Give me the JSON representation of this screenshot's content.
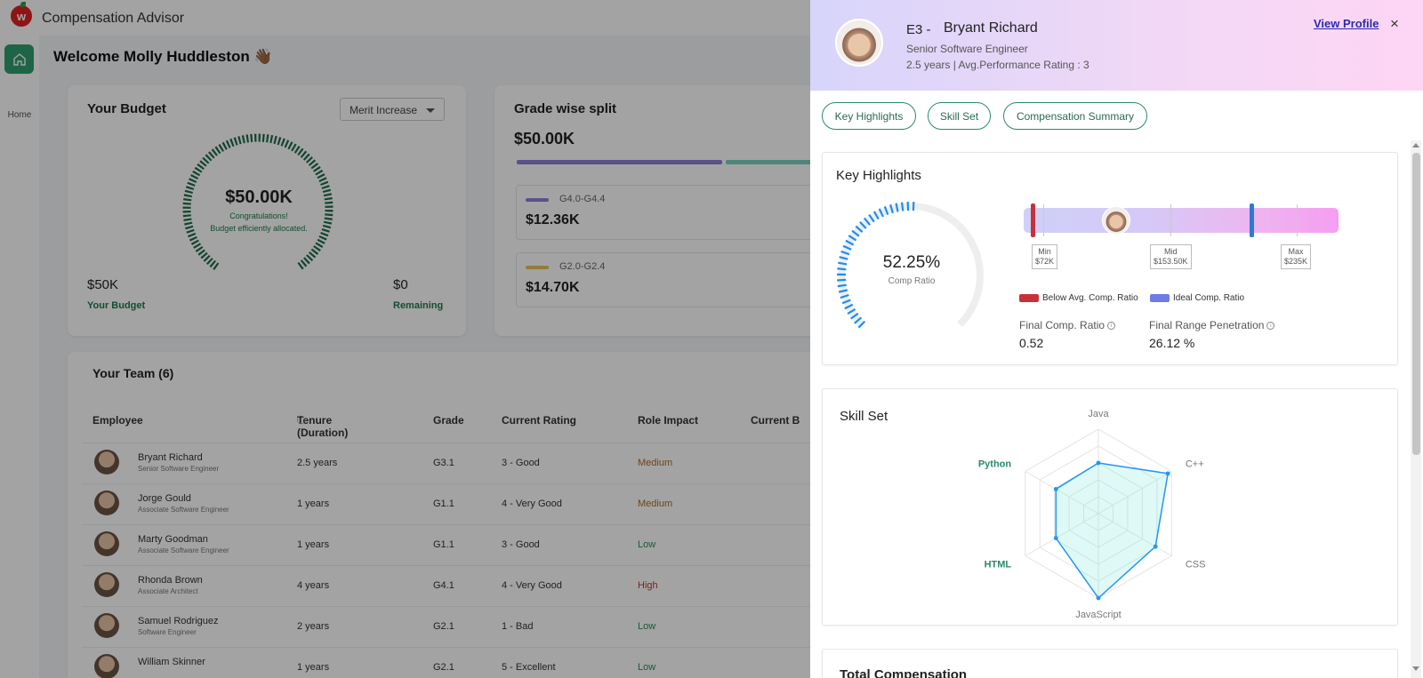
{
  "app": {
    "title": "Compensation Advisor",
    "logo": "w"
  },
  "nav": {
    "home_label": "Home"
  },
  "welcome": "Welcome Molly Huddleston 👋🏾",
  "budget": {
    "title": "Your Budget",
    "dropdown_value": "Merit Increase",
    "amount": "$50.00K",
    "message_line1": "Congratulations!",
    "message_line2": "Budget efficiently allocated.",
    "total_value": "$50K",
    "total_label": "Your Budget",
    "remaining_value": "$0",
    "remaining_label": "Remaining"
  },
  "grade_split": {
    "title": "Grade wise split",
    "total": "$50.00K",
    "items": [
      {
        "label": "G4.0-G4.4",
        "value": "$12.36K",
        "color": "#8c7fd8"
      },
      {
        "label": "G2.0-G2.4",
        "value": "$14.70K",
        "color": "#e6c05a"
      }
    ]
  },
  "team": {
    "title": "Your Team (6)",
    "columns": [
      "Employee",
      "Tenure (Duration)",
      "Grade",
      "Current Rating",
      "Role Impact",
      "Current B"
    ],
    "rows": [
      {
        "name": "Bryant Richard",
        "role": "Senior Software Engineer",
        "tenure": "2.5 years",
        "grade": "G3.1",
        "rating": "3 - Good",
        "impact": "Medium"
      },
      {
        "name": "Jorge Gould",
        "role": "Associate Software Engineer",
        "tenure": "1 years",
        "grade": "G1.1",
        "rating": "4 - Very Good",
        "impact": "Medium"
      },
      {
        "name": "Marty Goodman",
        "role": "Associate Software Engineer",
        "tenure": "1 years",
        "grade": "G1.1",
        "rating": "3 - Good",
        "impact": "Low"
      },
      {
        "name": "Rhonda Brown",
        "role": "Associate Architect",
        "tenure": "4 years",
        "grade": "G4.1",
        "rating": "4 - Very Good",
        "impact": "High"
      },
      {
        "name": "Samuel Rodriguez",
        "role": "Software Engineer",
        "tenure": "2 years",
        "grade": "G2.1",
        "rating": "1 - Bad",
        "impact": "Low"
      },
      {
        "name": "William Skinner",
        "role": "",
        "tenure": "1 years",
        "grade": "G2.1",
        "rating": "5 - Excellent",
        "impact": "Low"
      }
    ]
  },
  "drawer": {
    "code": "E3 -",
    "name": "Bryant Richard",
    "role": "Senior Software Engineer",
    "meta": "2.5 years | Avg.Performance Rating : 3",
    "view_profile": "View Profile",
    "close_icon": "×",
    "tabs": [
      "Key Highlights",
      "Skill Set",
      "Compensation Summary"
    ],
    "key_highlights": {
      "title": "Key Highlights",
      "comp_ratio_value": "52.25%",
      "comp_ratio_label": "Comp Ratio",
      "comp_ratio_fraction": 0.5225,
      "range": {
        "min_label": "Min",
        "min_value": "$72K",
        "mid_label": "Mid",
        "mid_value": "$153.50K",
        "max_label": "Max",
        "max_value": "$235K"
      },
      "legend_below": "Below Avg. Comp. Ratio",
      "legend_ideal": "Ideal Comp. Ratio",
      "below_color": "#c8313a",
      "ideal_color": "#6e7be6",
      "final_comp_ratio_label": "Final Comp. Ratio",
      "final_comp_ratio_value": "0.52",
      "final_range_penetration_label": "Final Range Penetration",
      "final_range_penetration_value": "26.12 %"
    },
    "skill_set": {
      "title": "Skill Set",
      "axes": [
        "Java",
        "C++",
        "CSS",
        "JavaScript",
        "HTML",
        "Python"
      ],
      "values": [
        0.6,
        0.95,
        0.78,
        1.0,
        0.58,
        0.58
      ]
    },
    "total_comp_title": "Total Compensation"
  }
}
